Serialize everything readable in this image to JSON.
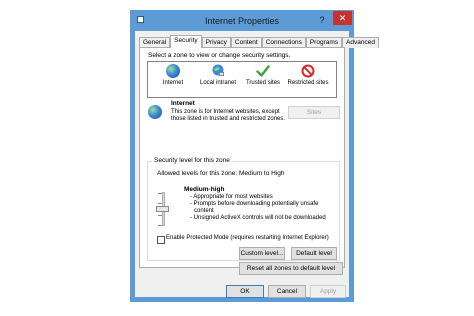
{
  "window": {
    "title": "Internet Properties",
    "help": "?",
    "close": "✕"
  },
  "tabs": [
    "General",
    "Security",
    "Privacy",
    "Content",
    "Connections",
    "Programs",
    "Advanced"
  ],
  "security": {
    "instruction": "Select a zone to view or change security settings.",
    "zones": [
      {
        "label": "Internet",
        "icon": "globe-icon"
      },
      {
        "label": "Local intranet",
        "icon": "intranet-globe-icon"
      },
      {
        "label": "Trusted sites",
        "icon": "checkmark-icon"
      },
      {
        "label": "Restricted sites",
        "icon": "prohibited-icon"
      }
    ],
    "selected_zone": {
      "title": "Internet",
      "description": "This zone is for Internet websites, except those listed in trusted and restricted zones."
    },
    "sites_button": "Sites",
    "group_label": "Security level for this zone",
    "allowed_levels": "Allowed levels for this zone: Medium to High",
    "level_name": "Medium-high",
    "level_points": [
      "- Appropriate for most websites",
      "- Prompts before downloading potentially unsafe",
      "  content",
      "- Unsigned ActiveX controls will not be downloaded"
    ],
    "protected_mode_label": "Enable Protected Mode (requires restarting Internet Explorer)",
    "custom_level_button": "Custom level...",
    "default_level_button": "Default level",
    "reset_all_button": "Reset all zones to default level"
  },
  "footer": {
    "ok": "OK",
    "cancel": "Cancel",
    "apply": "Apply"
  },
  "colors": {
    "accent": "#5d9bd6",
    "close": "#c7322e",
    "check": "#3aa63a",
    "prohibit": "#d42c2c"
  }
}
